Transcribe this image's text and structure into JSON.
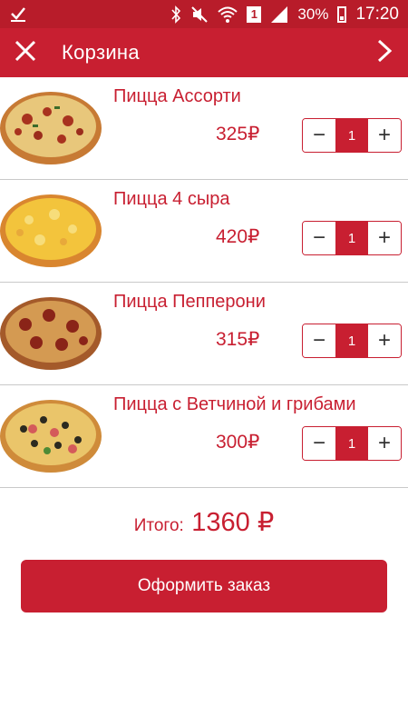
{
  "status_bar": {
    "time": "17:20",
    "battery": "30%",
    "sim": "1",
    "icons": [
      "check-icon",
      "bluetooth-icon",
      "mute-icon",
      "wifi-icon",
      "sim-icon",
      "signal-icon",
      "battery-icon"
    ]
  },
  "app_bar": {
    "title": "Корзина",
    "close_icon": "close-icon",
    "next_icon": "chevron-right-icon"
  },
  "cart": {
    "items": [
      {
        "name": "Пицца Ассорти",
        "price": "325₽",
        "qty": "1",
        "minus": "−",
        "plus": "+"
      },
      {
        "name": "Пицца 4 сыра",
        "price": "420₽",
        "qty": "1",
        "minus": "−",
        "plus": "+"
      },
      {
        "name": "Пицца Пепперони",
        "price": "315₽",
        "qty": "1",
        "minus": "−",
        "plus": "+"
      },
      {
        "name": "Пицца с Ветчиной и грибами",
        "price": "300₽",
        "qty": "1",
        "minus": "−",
        "plus": "+"
      }
    ]
  },
  "total": {
    "label": "Итого:",
    "value": "1360 ₽"
  },
  "order_button": {
    "label": "Оформить заказ"
  },
  "colors": {
    "accent": "#c81f31",
    "status_bar": "#b81c2a",
    "divider": "#c9c9c9"
  }
}
